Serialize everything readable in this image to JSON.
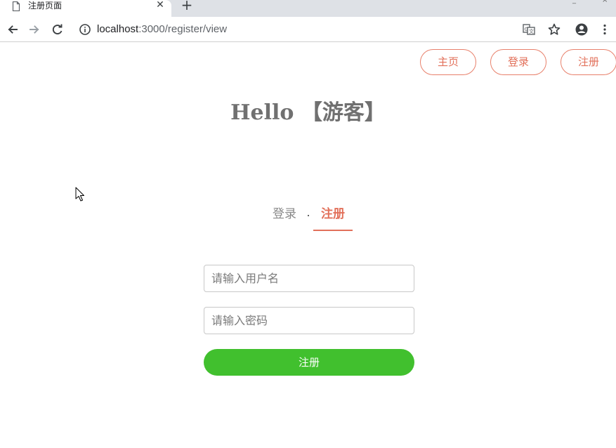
{
  "browser": {
    "tab_title": "注册页面",
    "tab_close": "✕",
    "new_tab": "+",
    "url_host": "localhost",
    "url_rest": ":3000/register/view",
    "icons": [
      "file-icon",
      "back-icon",
      "forward-icon",
      "reload-icon",
      "info-icon",
      "translate-icon",
      "star-icon",
      "account-icon",
      "menu-icon"
    ]
  },
  "nav": {
    "home": "主页",
    "login": "登录",
    "register": "注册"
  },
  "greeting": {
    "hello": "Hello",
    "user": "【游客】"
  },
  "tabs": {
    "login": "登录",
    "register": "注册",
    "active": "register"
  },
  "form": {
    "username_placeholder": "请输入用户名",
    "username_value": "",
    "password_placeholder": "请输入密码",
    "password_value": "",
    "submit_label": "注册"
  },
  "colors": {
    "accent": "#e2705a",
    "submit": "#41c02e",
    "text_muted": "#707070"
  }
}
